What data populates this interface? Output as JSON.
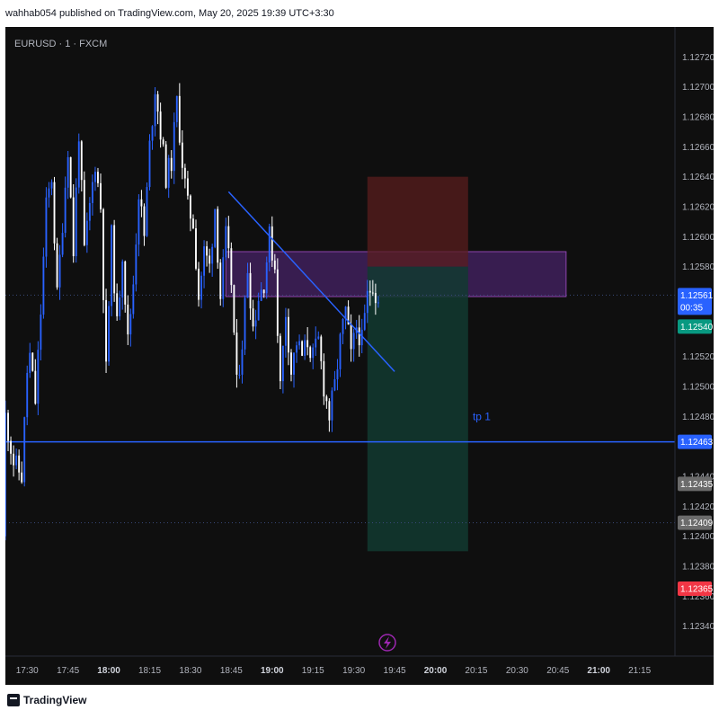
{
  "header": {
    "publisher_text": "wahhab054 published on TradingView.com, May 20, 2025 19:39 UTC+3:30"
  },
  "footer": {
    "brand": "TradingView"
  },
  "colors": {
    "background": "#0f0f0f",
    "candle_up": "#2962ff",
    "candle_down": "#ffffff",
    "trendline": "#2962ff",
    "tp_line": "#2962ff",
    "risk_zone": "#5a1e1e",
    "reward_zone": "#123a30",
    "supply_zone": "#5b2a86",
    "price_label_current": "#2962ff",
    "price_label_green": "#089981",
    "price_label_red": "#f23645",
    "price_label_gray": "#6b6b6b"
  },
  "chart_data": {
    "type": "candlestick",
    "symbol_label": "EURUSD · 1 · FXCM",
    "timeframe_minutes": 1,
    "x_ticks": [
      "17:30",
      "17:45",
      "18:00",
      "18:15",
      "18:30",
      "18:45",
      "19:00",
      "19:15",
      "19:30",
      "19:45",
      "20:00",
      "20:15",
      "20:30",
      "20:45",
      "21:00",
      "21:15"
    ],
    "y_ticks": [
      "1.12720",
      "1.12700",
      "1.12680",
      "1.12660",
      "1.12640",
      "1.12620",
      "1.12600",
      "1.12580",
      "1.12520",
      "1.12500",
      "1.12480",
      "1.12440",
      "1.12420",
      "1.12400",
      "1.12380",
      "1.12360",
      "1.12340"
    ],
    "y_range": [
      1.1232,
      1.1274
    ],
    "x_range": [
      "17:22",
      "21:28"
    ],
    "keypoints": [
      [
        "17:22",
        1.124
      ],
      [
        "17:23",
        1.1248
      ],
      [
        "17:26",
        1.1245
      ],
      [
        "17:29",
        1.1244
      ],
      [
        "17:31",
        1.1251
      ],
      [
        "17:32",
        1.1252
      ],
      [
        "17:34",
        1.1249
      ],
      [
        "17:36",
        1.1255
      ],
      [
        "17:38",
        1.1262
      ],
      [
        "17:40",
        1.1264
      ],
      [
        "17:42",
        1.1256
      ],
      [
        "17:44",
        1.1261
      ],
      [
        "17:46",
        1.1266
      ],
      [
        "17:48",
        1.1259
      ],
      [
        "17:50",
        1.1267
      ],
      [
        "17:52",
        1.1259
      ],
      [
        "17:54",
        1.1262
      ],
      [
        "17:56",
        1.1265
      ],
      [
        "17:58",
        1.1262
      ],
      [
        "18:00",
        1.1251
      ],
      [
        "18:02",
        1.126
      ],
      [
        "18:04",
        1.1254
      ],
      [
        "18:06",
        1.1259
      ],
      [
        "18:08",
        1.1253
      ],
      [
        "18:10",
        1.1257
      ],
      [
        "18:12",
        1.1263
      ],
      [
        "18:14",
        1.126
      ],
      [
        "18:16",
        1.1266
      ],
      [
        "18:18",
        1.127
      ],
      [
        "18:20",
        1.1267
      ],
      [
        "18:22",
        1.1264
      ],
      [
        "18:24",
        1.1265
      ],
      [
        "18:26",
        1.1269
      ],
      [
        "18:28",
        1.1265
      ],
      [
        "18:30",
        1.1262
      ],
      [
        "18:32",
        1.1261
      ],
      [
        "18:34",
        1.1256
      ],
      [
        "18:36",
        1.1259
      ],
      [
        "18:38",
        1.1258
      ],
      [
        "18:40",
        1.1262
      ],
      [
        "18:42",
        1.1256
      ],
      [
        "18:44",
        1.126
      ],
      [
        "18:46",
        1.1257
      ],
      [
        "18:48",
        1.125
      ],
      [
        "18:50",
        1.1253
      ],
      [
        "18:52",
        1.1258
      ],
      [
        "18:54",
        1.1254
      ],
      [
        "18:56",
        1.1256
      ],
      [
        "18:58",
        1.1257
      ],
      [
        "19:00",
        1.126
      ],
      [
        "19:02",
        1.1258
      ],
      [
        "19:04",
        1.125
      ],
      [
        "19:06",
        1.1255
      ],
      [
        "19:08",
        1.1251
      ],
      [
        "19:10",
        1.1253
      ],
      [
        "19:12",
        1.1252
      ],
      [
        "19:14",
        1.1253
      ],
      [
        "19:16",
        1.1252
      ],
      [
        "19:18",
        1.1253
      ],
      [
        "19:20",
        1.125
      ],
      [
        "19:22",
        1.1248
      ],
      [
        "19:24",
        1.125
      ],
      [
        "19:26",
        1.1253
      ],
      [
        "19:28",
        1.1255
      ],
      [
        "19:30",
        1.1252
      ],
      [
        "19:32",
        1.1254
      ],
      [
        "19:34",
        1.1253
      ],
      [
        "19:36",
        1.1256
      ],
      [
        "19:38",
        1.1257
      ],
      [
        "19:39",
        1.12561
      ]
    ],
    "current_price": "1.12561",
    "countdown": "00:35",
    "price_labels": [
      {
        "text": "1.12540",
        "value": 1.1254,
        "style": "green"
      },
      {
        "text": "1.12463",
        "value": 1.12463,
        "style": "blue"
      },
      {
        "text": "1.12435",
        "value": 1.12435,
        "style": "gray"
      },
      {
        "text": "1.12409",
        "value": 1.12409,
        "style": "gray"
      },
      {
        "text": "1.12365",
        "value": 1.12365,
        "style": "red"
      }
    ],
    "trendline": {
      "start": [
        "18:44",
        1.1263
      ],
      "end": [
        "19:45",
        1.1251
      ]
    },
    "horizontal_lines": [
      {
        "value": 1.12463,
        "label": "tp 1",
        "label_time": "20:17",
        "start": "17:22",
        "end": "21:28",
        "style": "solid"
      },
      {
        "value": 1.12561,
        "start": "17:22",
        "end": "21:28",
        "style": "dotted"
      },
      {
        "value": 1.12409,
        "start": "17:22",
        "end": "21:28",
        "style": "dotted"
      }
    ],
    "zones": [
      {
        "kind": "supply",
        "time": [
          "18:43",
          "20:48"
        ],
        "price": [
          1.1256,
          1.1259
        ]
      },
      {
        "kind": "stop",
        "time": [
          "19:35",
          "20:12"
        ],
        "price": [
          1.1258,
          1.1264
        ]
      },
      {
        "kind": "target",
        "time": [
          "19:35",
          "20:12"
        ],
        "price": [
          1.1239,
          1.1258
        ]
      }
    ]
  }
}
